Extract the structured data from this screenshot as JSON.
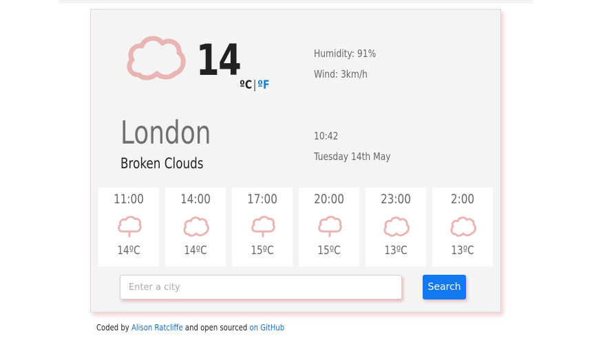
{
  "current": {
    "temperature": "14",
    "unit_c": "ºC",
    "unit_sep": "|",
    "unit_f": "ºF",
    "humidity": "Humidity: 91%",
    "wind": "Wind: 3km/h",
    "city": "London",
    "description": "Broken Clouds",
    "time": "10:42",
    "date": "Tuesday 14th May",
    "icon": "cloud-icon"
  },
  "forecast": [
    {
      "time": "11:00",
      "temp": "14ºC",
      "icon": "rain-cloud-icon"
    },
    {
      "time": "14:00",
      "temp": "14ºC",
      "icon": "cloud-icon"
    },
    {
      "time": "17:00",
      "temp": "15ºC",
      "icon": "rain-cloud-icon"
    },
    {
      "time": "20:00",
      "temp": "15ºC",
      "icon": "rain-cloud-icon"
    },
    {
      "time": "23:00",
      "temp": "13ºC",
      "icon": "cloud-icon"
    },
    {
      "time": "2:00",
      "temp": "13ºC",
      "icon": "cloud-icon"
    }
  ],
  "search": {
    "placeholder": "Enter a city",
    "value": "",
    "button_label": "Search"
  },
  "footer": {
    "prefix": "Coded by ",
    "author": "Alison Ratcliffe",
    "middle": " and open sourced ",
    "link": "on GitHub"
  },
  "colors": {
    "accent": "#1279f0",
    "icon_stroke": "#e8b4b4",
    "link": "#1a6fc4"
  }
}
